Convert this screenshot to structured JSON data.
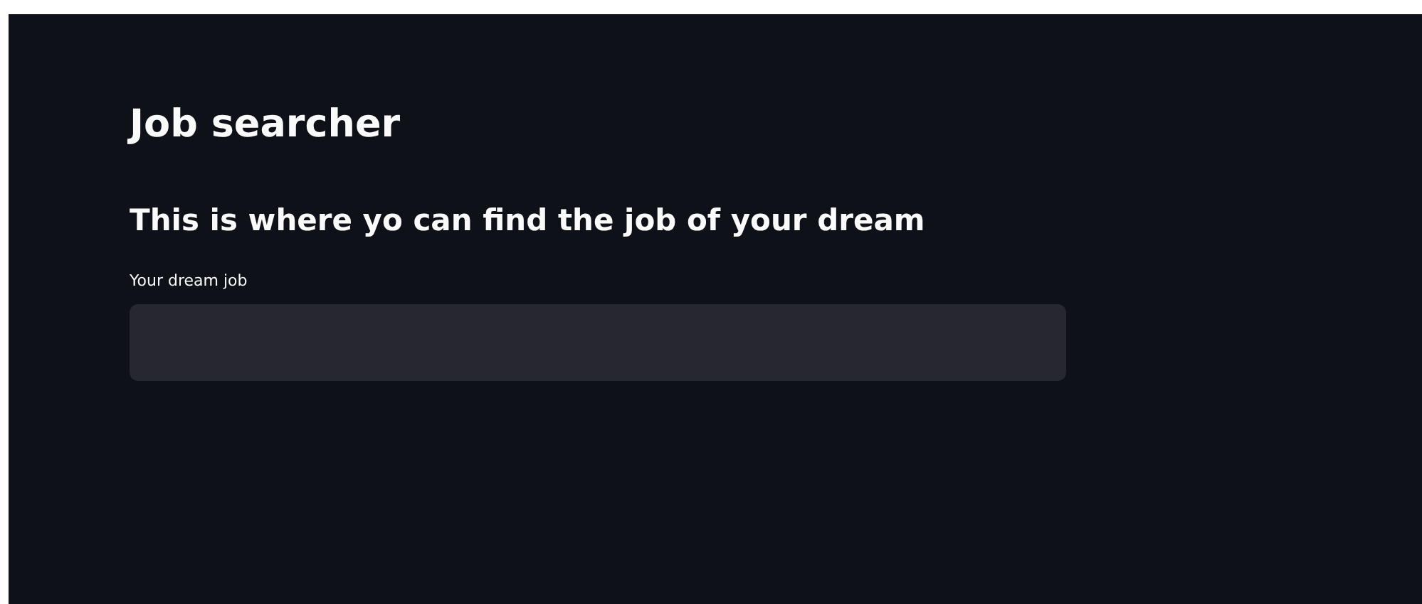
{
  "title": "Job searcher",
  "subtitle": "This is where yo can find the job of your dream",
  "field": {
    "label": "Your dream job"
  }
}
